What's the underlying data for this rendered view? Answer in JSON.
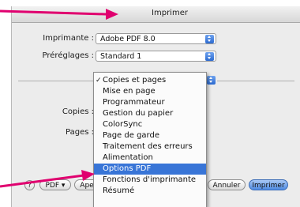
{
  "window": {
    "title": "Imprimer"
  },
  "printer": {
    "label": "Imprimante :",
    "value": "Adobe PDF 8.0"
  },
  "presets": {
    "label": "Préréglages :",
    "value": "Standard 1"
  },
  "section": {
    "value": "Copies et pages"
  },
  "copies": {
    "label": "Copies :"
  },
  "pages": {
    "label": "Pages :"
  },
  "menu": {
    "items": [
      {
        "label": "Copies et pages",
        "checked": true
      },
      {
        "label": "Mise en page"
      },
      {
        "label": "Programmateur"
      },
      {
        "label": "Gestion du papier"
      },
      {
        "label": "ColorSync"
      },
      {
        "label": "Page de garde"
      },
      {
        "label": "Traitement des erreurs"
      },
      {
        "label": "Alimentation"
      },
      {
        "label": "Options PDF",
        "selected": true
      },
      {
        "label": "Fonctions d'imprimante"
      },
      {
        "label": "Résumé"
      }
    ]
  },
  "buttons": {
    "help": "?",
    "pdf": "PDF ▾",
    "preview_partial": "Ape",
    "cancel": "Annuler",
    "print": "Imprimer"
  },
  "colors": {
    "accent": "#3875d7",
    "callout": "#e0006f"
  }
}
